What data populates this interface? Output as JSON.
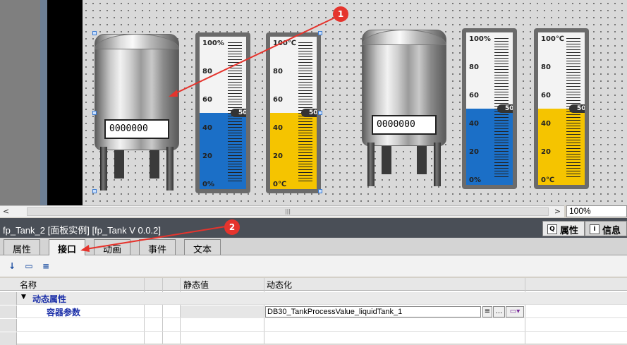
{
  "tanks": [
    {
      "value": "0000000"
    },
    {
      "value": "0000000"
    }
  ],
  "gauges": [
    {
      "fill_color": "#1b6fc7",
      "level_percent": 50,
      "pointer": "50",
      "labels": [
        "100%",
        "80",
        "60",
        "40",
        "20",
        "0%"
      ]
    },
    {
      "fill_color": "#f5c400",
      "level_percent": 50,
      "pointer": "50",
      "labels": [
        "100℃",
        "80",
        "60",
        "40",
        "20",
        "0℃"
      ]
    },
    {
      "fill_color": "#1b6fc7",
      "level_percent": 50,
      "pointer": "50",
      "labels": [
        "100%",
        "80",
        "60",
        "40",
        "20",
        "0%"
      ]
    },
    {
      "fill_color": "#f5c400",
      "level_percent": 50,
      "pointer": "50",
      "labels": [
        "100℃",
        "80",
        "60",
        "40",
        "20",
        "0℃"
      ]
    }
  ],
  "markers": [
    "1",
    "2"
  ],
  "scrollbar": {
    "left": "<",
    "right": ">",
    "grip": "|||"
  },
  "zoom": "100%",
  "title": "fp_Tank_2 [面板实例] [fp_Tank V 0.0.2]",
  "right_tabs": [
    {
      "label": "属性",
      "icon": "Q"
    },
    {
      "label": "信息",
      "icon": "i"
    }
  ],
  "prop_tabs": [
    "属性",
    "接口",
    "动画",
    "事件",
    "文本"
  ],
  "grid": {
    "headers": {
      "name": "名称",
      "static": "静态值",
      "dynamic": "动态化"
    },
    "group": "动态属性",
    "item": {
      "name": "容器参数",
      "dynamic": "DB30_TankProcessValue_liquidTank_1"
    }
  },
  "toolbar_icons": [
    "sort-az-icon",
    "folder-icon",
    "list-icon"
  ],
  "toolbar_glyphs": [
    "↓",
    "▭",
    "≡"
  ],
  "colors": {
    "title_bg": "#4a4f57",
    "accent_blue": "#1b2fa8",
    "marker_red": "#e5342d"
  }
}
